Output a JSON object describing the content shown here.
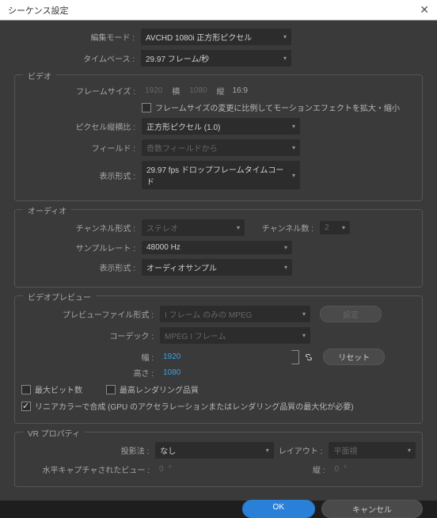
{
  "title": "シーケンス設定",
  "editmode": {
    "label": "編集モード :",
    "value": "AVCHD 1080i 正方形ピクセル"
  },
  "timebase": {
    "label": "タイムベース :",
    "value": "29.97 フレーム/秒"
  },
  "video": {
    "heading": "ビデオ",
    "framesize": {
      "label": "フレームサイズ :",
      "w": "1920",
      "mid1": "横",
      "h": "1080",
      "mid2": "縦",
      "aspect": "16:9"
    },
    "scale_checkbox": "フレームサイズの変更に比例してモーションエフェクトを拡大・縮小",
    "par": {
      "label": "ピクセル縦横比 :",
      "value": "正方形ピクセル (1.0)"
    },
    "fields": {
      "label": "フィールド :",
      "value": "奇数フィールドから"
    },
    "display": {
      "label": "表示形式 :",
      "value": "29.97 fps ドロップフレームタイムコード"
    }
  },
  "audio": {
    "heading": "オーディオ",
    "chfmt": {
      "label": "チャンネル形式 :",
      "value": "ステレオ"
    },
    "chcount": {
      "label": "チャンネル数 :",
      "value": "2"
    },
    "rate": {
      "label": "サンプルレート :",
      "value": "48000 Hz"
    },
    "display": {
      "label": "表示形式 :",
      "value": "オーディオサンプル"
    }
  },
  "preview": {
    "heading": "ビデオプレビュー",
    "filefmt": {
      "label": "プレビューファイル形式 :",
      "value": "I フレーム のみの MPEG"
    },
    "configure": "設定",
    "codec": {
      "label": "コーデック :",
      "value": "MPEG I フレーム"
    },
    "width": {
      "label": "幅 :",
      "value": "1920"
    },
    "height": {
      "label": "高さ :",
      "value": "1080"
    },
    "reset": "リセット",
    "maxbit": "最大ビット数",
    "maxrender": "最高レンダリング品質",
    "linear": "リニアカラーで合成 (GPU のアクセラレーションまたはレンダリング品質の最大化が必要)"
  },
  "vr": {
    "heading": "VR プロパティ",
    "projection": {
      "label": "投影法 :",
      "value": "なし"
    },
    "layout": {
      "label": "レイアウト :",
      "value": "平面視"
    },
    "horiz": {
      "label": "水平キャプチャされたビュー :",
      "value": "0"
    },
    "vert": {
      "label": "縦 :",
      "value": "0"
    },
    "deg": "°"
  },
  "buttons": {
    "ok": "OK",
    "cancel": "キャンセル"
  }
}
